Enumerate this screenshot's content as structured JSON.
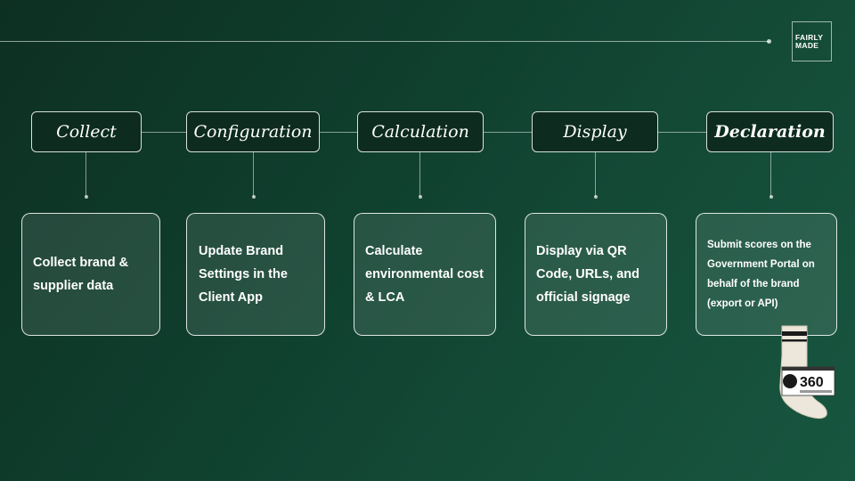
{
  "logo": {
    "line1": "FAIRLY",
    "line2": "MADE"
  },
  "steps": [
    {
      "label": "Collect",
      "description": "Collect brand & supplier data"
    },
    {
      "label": "Configuration",
      "description": "Update Brand Settings in the Client App"
    },
    {
      "label": "Calculation",
      "description": "Calculate environmental cost & LCA"
    },
    {
      "label": "Display",
      "description": "Display via QR Code, URLs, and official signage"
    },
    {
      "label": "Declaration",
      "description": "Submit scores on the Government Portal on behalf of the brand (export or API)"
    }
  ],
  "sock_label": {
    "score": "360"
  },
  "colors": {
    "background": "#0f3d2c",
    "box_fill": "#0d2b1f",
    "stroke": "#ffffff"
  }
}
